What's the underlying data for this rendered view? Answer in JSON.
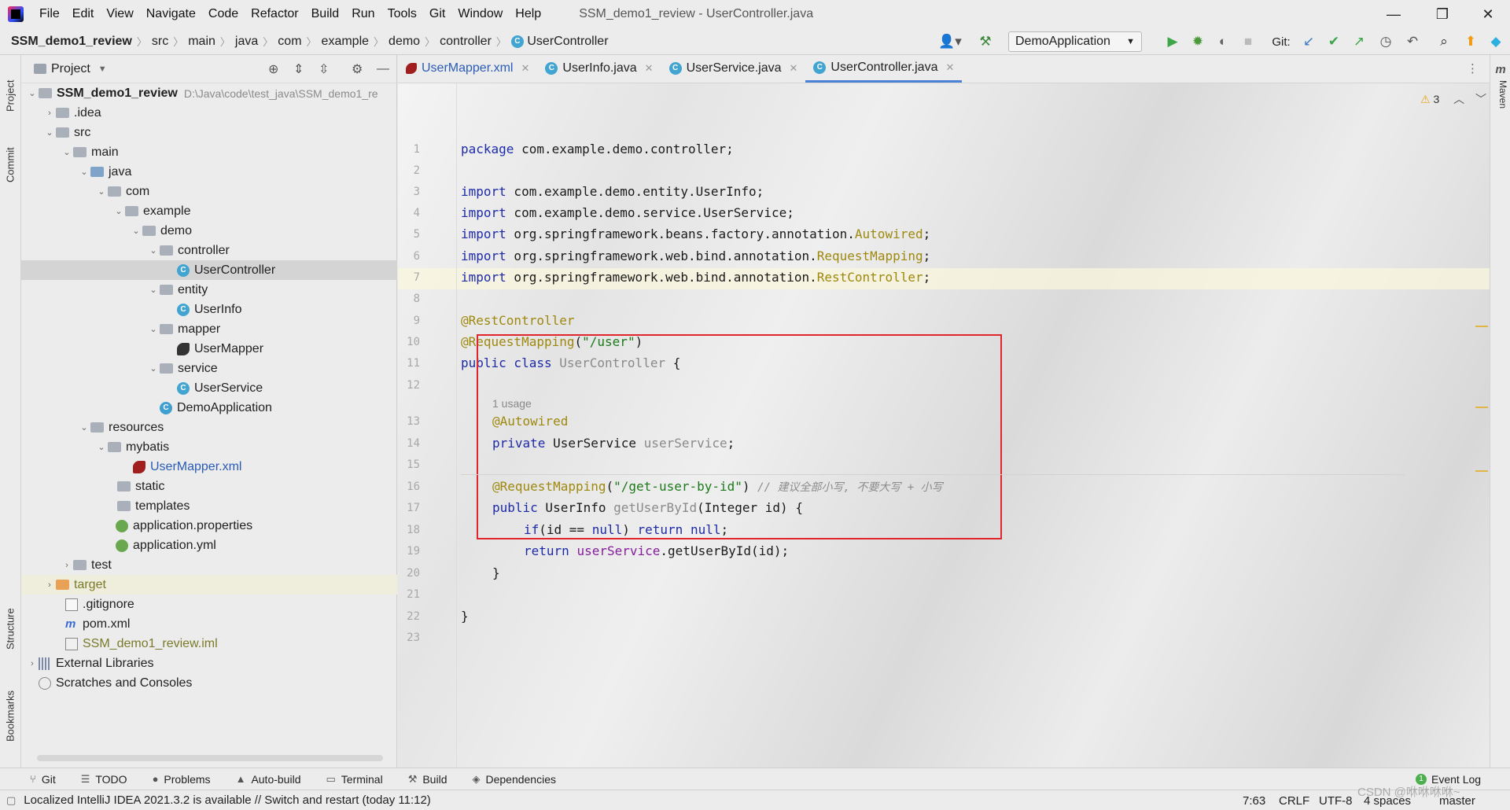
{
  "menu": [
    "File",
    "Edit",
    "View",
    "Navigate",
    "Code",
    "Refactor",
    "Build",
    "Run",
    "Tools",
    "Git",
    "Window",
    "Help"
  ],
  "window_title": "SSM_demo1_review - UserController.java",
  "window_controls": [
    "—",
    "❐",
    "✕"
  ],
  "breadcrumb": [
    "SSM_demo1_review",
    "src",
    "main",
    "java",
    "com",
    "example",
    "demo",
    "controller",
    "UserController"
  ],
  "run_config": "DemoApplication",
  "git_label": "Git:",
  "left_tabs": [
    "Project",
    "Commit",
    "Structure",
    "Bookmarks"
  ],
  "right_tabs": [
    "Maven"
  ],
  "project_panel": {
    "title": "Project"
  },
  "tree": [
    {
      "label": "SSM_demo1_review",
      "path": "D:\\Java\\code\\test_java\\SSM_demo1_re"
    },
    {
      "label": ".idea"
    },
    {
      "label": "src"
    },
    {
      "label": "main"
    },
    {
      "label": "java"
    },
    {
      "label": "com"
    },
    {
      "label": "example"
    },
    {
      "label": "demo"
    },
    {
      "label": "controller"
    },
    {
      "label": "UserController"
    },
    {
      "label": "entity"
    },
    {
      "label": "UserInfo"
    },
    {
      "label": "mapper"
    },
    {
      "label": "UserMapper"
    },
    {
      "label": "service"
    },
    {
      "label": "UserService"
    },
    {
      "label": "DemoApplication"
    },
    {
      "label": "resources"
    },
    {
      "label": "mybatis"
    },
    {
      "label": "UserMapper.xml"
    },
    {
      "label": "static"
    },
    {
      "label": "templates"
    },
    {
      "label": "application.properties"
    },
    {
      "label": "application.yml"
    },
    {
      "label": "test"
    },
    {
      "label": "target"
    },
    {
      "label": ".gitignore"
    },
    {
      "label": "pom.xml"
    },
    {
      "label": "SSM_demo1_review.iml"
    },
    {
      "label": "External Libraries"
    },
    {
      "label": "Scratches and Consoles"
    }
  ],
  "editor_tabs": [
    "UserMapper.xml",
    "UserInfo.java",
    "UserService.java",
    "UserController.java"
  ],
  "warnings": "3",
  "line_numbers": [
    "1",
    "2",
    "3",
    "4",
    "5",
    "6",
    "7",
    "8",
    "9",
    "10",
    "11",
    "12",
    "13",
    "14",
    "15",
    "16",
    "17",
    "18",
    "19",
    "20",
    "21",
    "22",
    "23"
  ],
  "code": {
    "l1_kw": "package",
    "l1_rest": " com.example.demo.controller;",
    "import_kw": "import",
    "l3": " com.example.demo.entity.UserInfo;",
    "l4": " com.example.demo.service.UserService;",
    "l5a": " org.springframework.beans.factory.annotation.",
    "l5b": "Autowired",
    "l5c": ";",
    "l6a": " org.springframework.web.bind.annotation.",
    "l6b": "RequestMapping",
    "l6c": ";",
    "l7a": " org.springframework.web.bind.annotation.",
    "l7b": "RestController",
    "l7c": ";",
    "l9": "@RestController",
    "l10a": "@RequestMapping",
    "l10b": "(",
    "l10c": "\"/user\"",
    "l10d": ")",
    "l11a": "public class",
    "l11b": " UserController",
    "l11c": " {",
    "usage": "1 usage",
    "l13": "@Autowired",
    "l14a": "private",
    "l14b": " UserService ",
    "l14c": "userService",
    "l14d": ";",
    "l16a": "@RequestMapping",
    "l16b": "(",
    "l16c": "\"/get-user-by-id\"",
    "l16d": ") ",
    "l16e": "// 建议全部小写, 不要大写 + 小写",
    "l17a": "public",
    "l17b": " UserInfo ",
    "l17c": "getUserById",
    "l17d": "(Integer id) {",
    "l18a": "if",
    "l18b": "(id == ",
    "l18c": "null",
    "l18d": ") ",
    "l18e": "return",
    "l18f": " ",
    "l18g": "null",
    "l18h": ";",
    "l19a": "return",
    "l19b": " ",
    "l19c": "userService",
    "l19d": ".getUserById(id);",
    "l20": "}",
    "l22": "}"
  },
  "bottom_tools": [
    "Git",
    "TODO",
    "Problems",
    "Auto-build",
    "Terminal",
    "Build",
    "Dependencies"
  ],
  "event_log": "Event Log",
  "status": {
    "message": "Localized IntelliJ IDEA 2021.3.2 is available // Switch and restart (today 11:12)",
    "position": "7:63",
    "line_sep": "CRLF",
    "encoding": "UTF-8",
    "indent": "4 spaces",
    "branch": "master",
    "watermark": "CSDN @咻咻咻咻~"
  }
}
